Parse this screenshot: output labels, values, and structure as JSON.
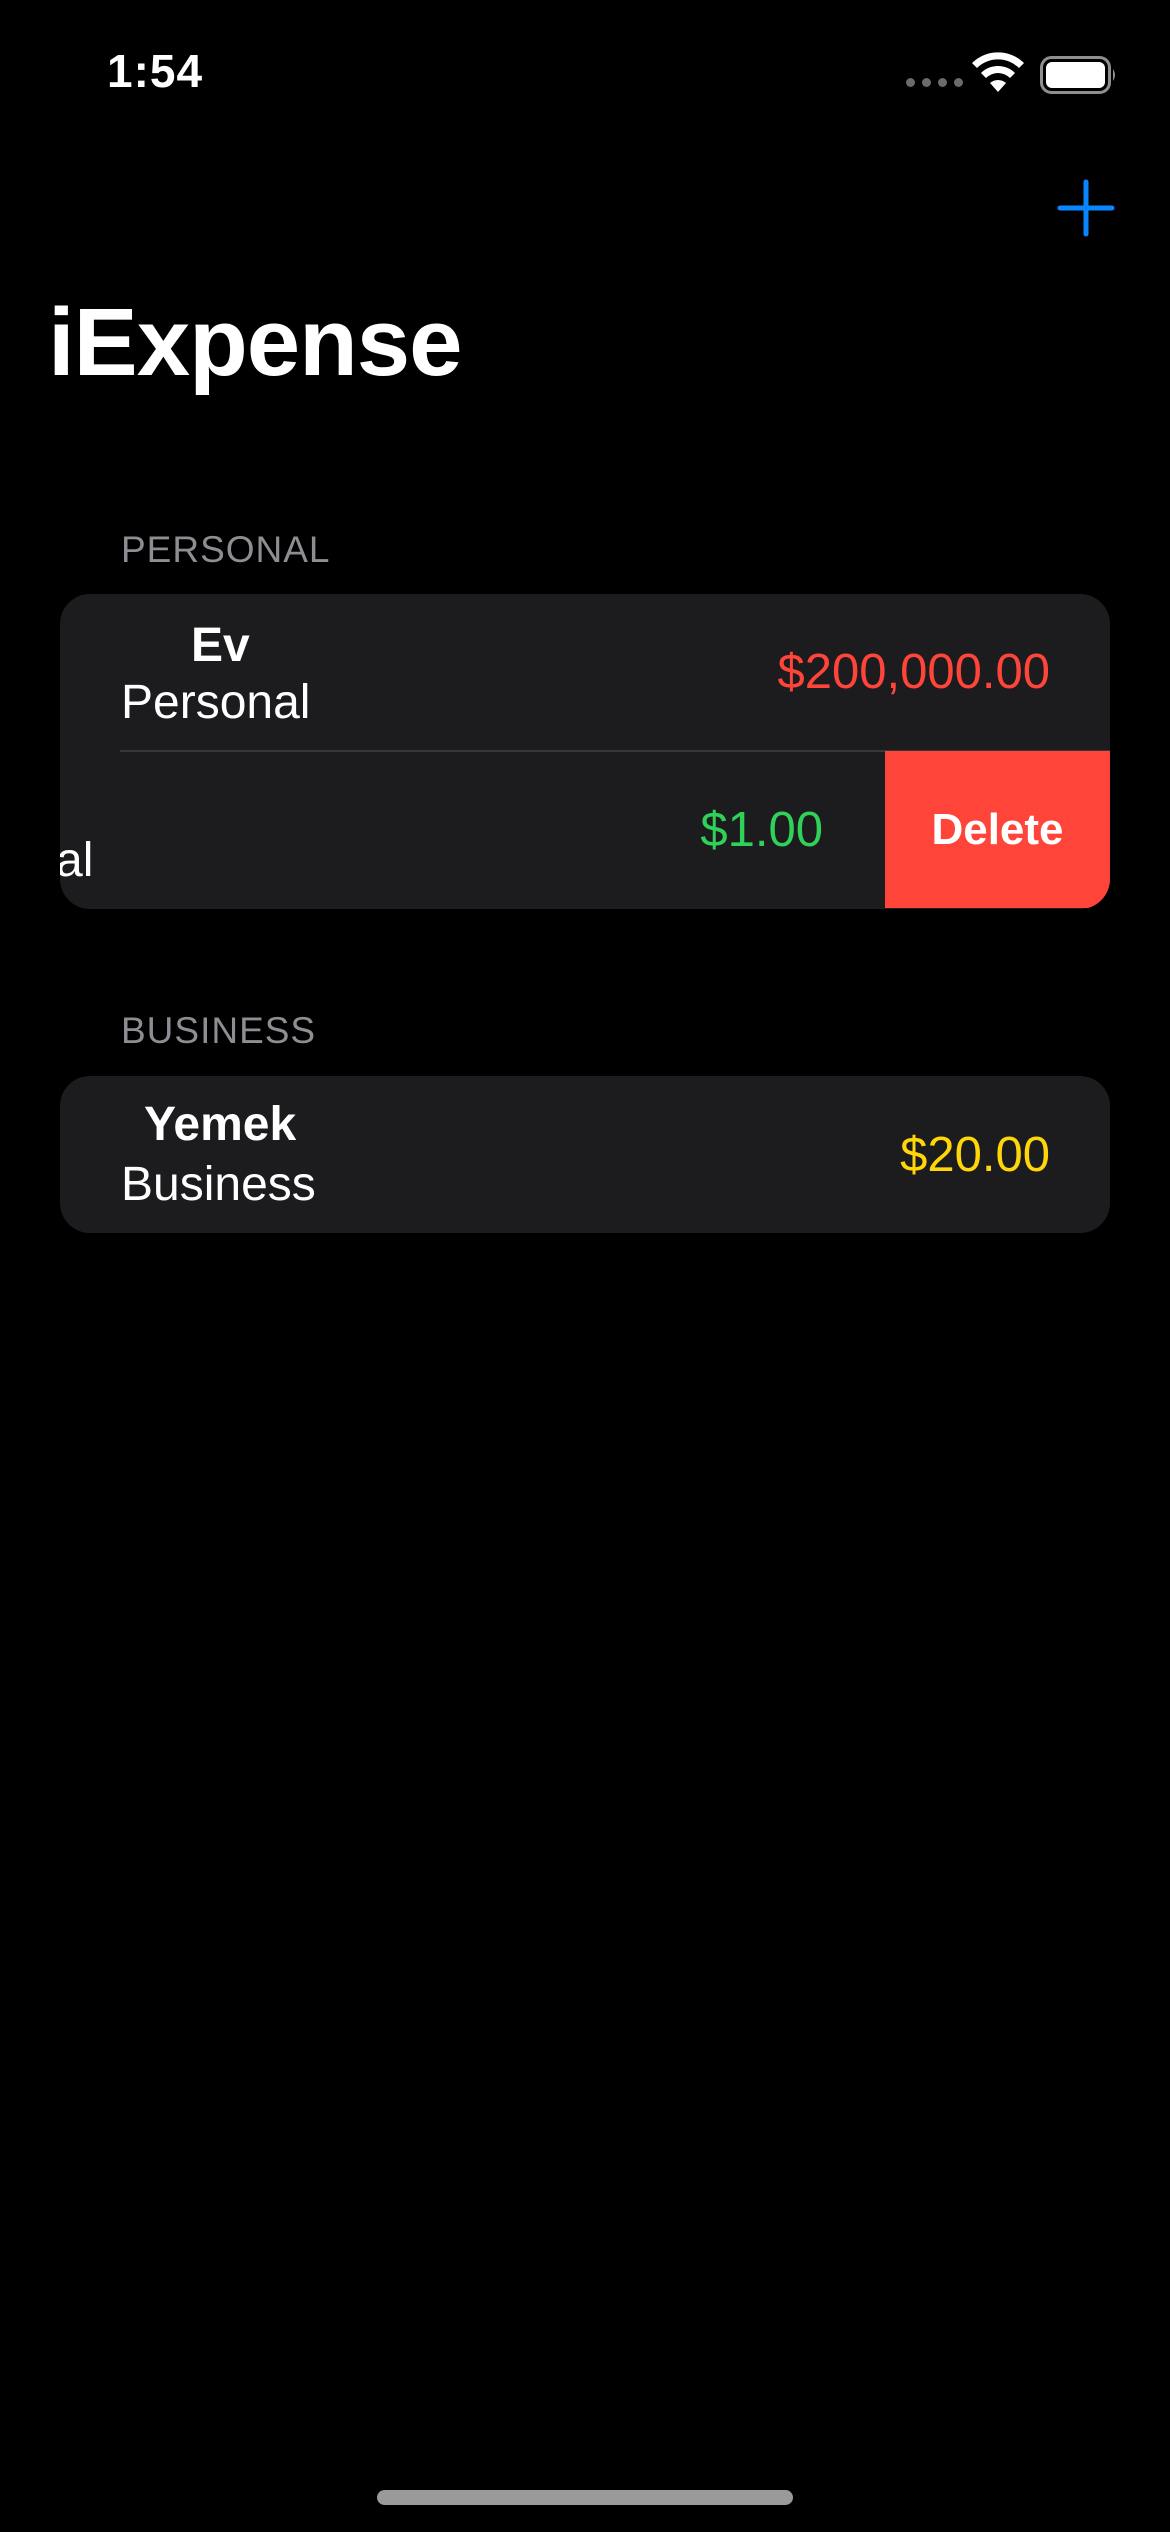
{
  "status_bar": {
    "time": "1:54"
  },
  "nav": {
    "title": "iExpense",
    "add_icon": "plus-icon"
  },
  "sections": [
    {
      "header": "PERSONAL",
      "items": [
        {
          "name": "Ev",
          "type": "Personal",
          "amount": "$200,000.00",
          "amount_color": "#ff453a"
        },
        {
          "name": "",
          "type_partial": "al",
          "amount": "$1.00",
          "amount_color": "#30d158",
          "swipe_action": "Delete"
        }
      ]
    },
    {
      "header": "BUSINESS",
      "items": [
        {
          "name": "Yemek",
          "type": "Business",
          "amount": "$20.00",
          "amount_color": "#ffd60a"
        }
      ]
    }
  ],
  "colors": {
    "accent": "#0a84ff",
    "delete": "#ff453a",
    "card": "#1c1c1e"
  }
}
